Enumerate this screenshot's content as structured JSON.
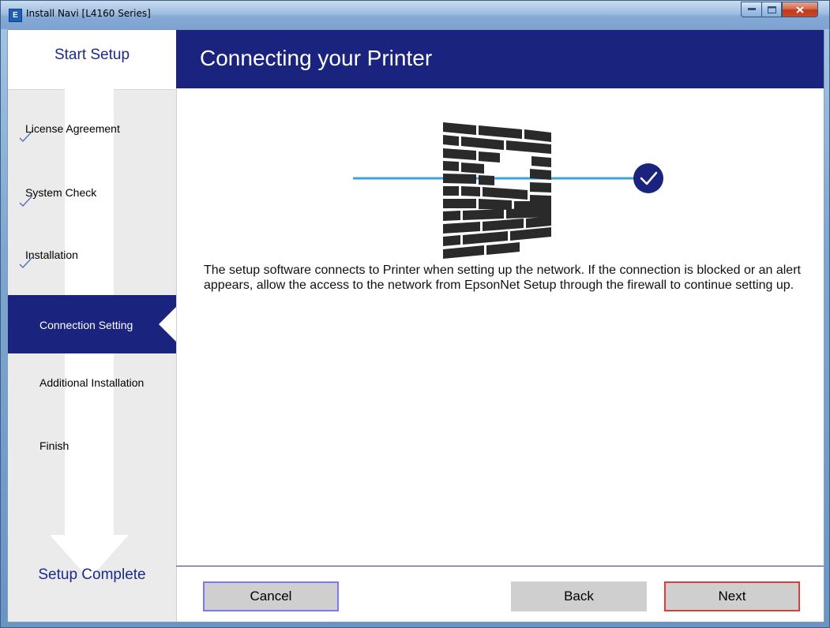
{
  "window": {
    "title": "Install Navi [L4160 Series]",
    "app_icon_letter": "E",
    "icon_names": [
      "minimize-icon",
      "maximize-icon",
      "close-icon"
    ]
  },
  "sidebar": {
    "top_label": "Start Setup",
    "bottom_label": "Setup Complete",
    "steps": [
      {
        "label": "License Agreement",
        "state": "done"
      },
      {
        "label": "System Check",
        "state": "done"
      },
      {
        "label": "Installation",
        "state": "done"
      },
      {
        "label": "Connection Setting",
        "state": "active"
      },
      {
        "label": "Additional Installation",
        "state": "pending"
      },
      {
        "label": "Finish",
        "state": "pending"
      }
    ]
  },
  "header": {
    "title": "Connecting your Printer"
  },
  "main": {
    "description": "The setup software connects to Printer when setting up the network. If the connection is blocked or an alert appears, allow the access to the network from EpsonNet Setup through the firewall to continue setting up.",
    "illustration": "firewall-icon"
  },
  "buttons": {
    "cancel": "Cancel",
    "back": "Back",
    "next": "Next"
  },
  "colors": {
    "header_bg": "#1a237e",
    "accent_line": "#3aa6dd",
    "check_circle": "#1a237e",
    "cancel_border": "#7a78ff",
    "next_border": "#e03a3a"
  }
}
